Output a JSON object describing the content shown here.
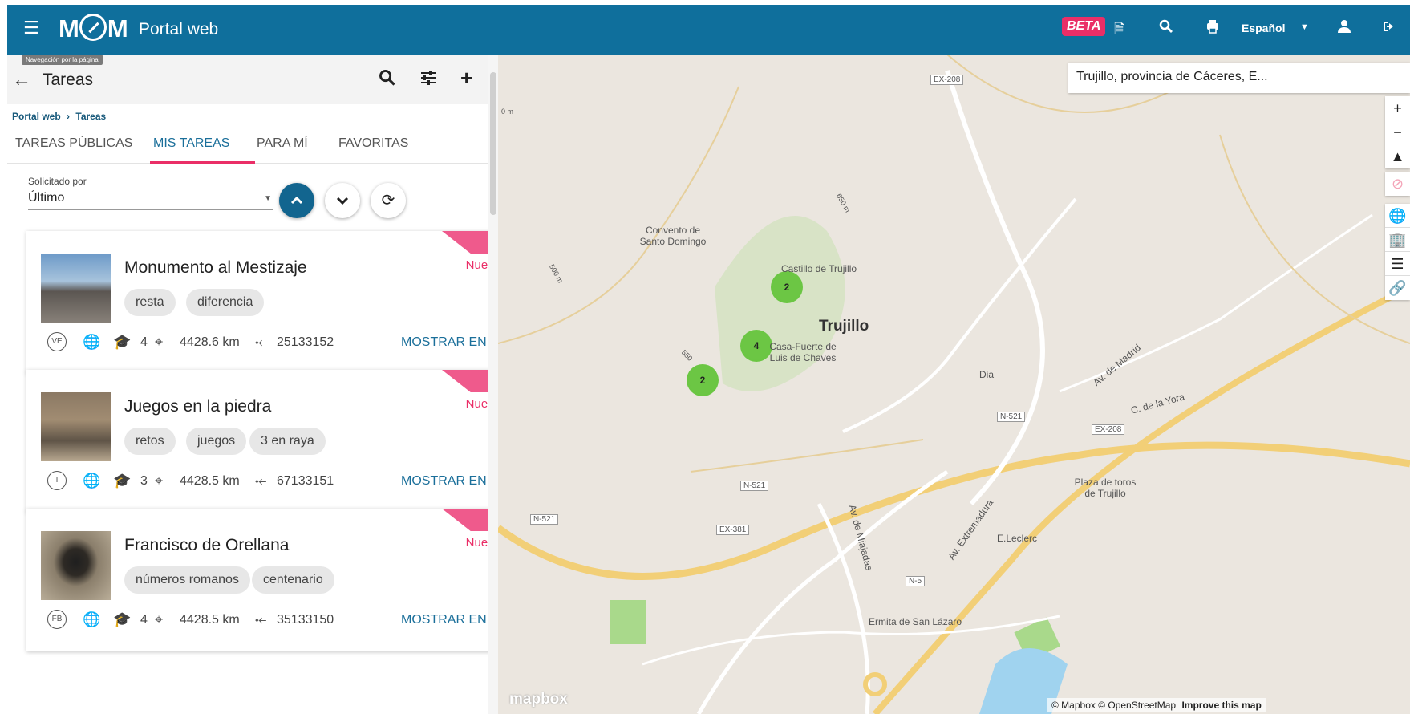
{
  "topbar": {
    "brand": "M",
    "brand_end": "M",
    "portal_title": "Portal web",
    "beta": "BETA",
    "language": "Español"
  },
  "header": {
    "tooltip": "Navegación por la página",
    "title": "Tareas"
  },
  "breadcrumb": {
    "home": "Portal web",
    "sep": "›",
    "current": "Tareas"
  },
  "tabs": [
    {
      "label": "TAREAS PÚBLICAS"
    },
    {
      "label": "MIS TAREAS"
    },
    {
      "label": "PARA MÍ"
    },
    {
      "label": "FAVORITAS"
    }
  ],
  "sort": {
    "label": "Solicitado por",
    "value": "Último"
  },
  "cards": [
    {
      "title": "Monumento al Mestizaje",
      "badge": "Nuevo",
      "tags": [
        "resta",
        "diferencia"
      ],
      "type": "VE",
      "level": "4",
      "distance": "4428.6 km",
      "id": "25133152",
      "action": "MOSTRAR EN EL"
    },
    {
      "title": "Juegos en la piedra",
      "badge": "Nuevo",
      "tags": [
        "retos",
        "juegos",
        "3 en raya"
      ],
      "type": "I",
      "level": "3",
      "distance": "4428.5 km",
      "id": "67133151",
      "action": "MOSTRAR EN EL"
    },
    {
      "title": "Francisco de Orellana",
      "badge": "Nuevo",
      "tags": [
        "números romanos",
        "centenario"
      ],
      "type": "FB",
      "level": "4",
      "distance": "4428.5 km",
      "id": "35133150",
      "action": "MOSTRAR EN EL"
    }
  ],
  "map": {
    "search": "Trujillo, provincia de Cáceres, E...",
    "clusters": [
      "2",
      "4",
      "2"
    ],
    "labels": {
      "trujillo": "Trujillo",
      "castillo": "Castillo de Trujillo",
      "convento": "Convento de Santo Domingo",
      "casa_fuerte": "Casa-Fuerte de Luis de Chaves",
      "dia": "Dia",
      "madrid": "Av. de Madrid",
      "yora": "C. de la Yora",
      "plaza_toros": "Plaza de toros de Trujillo",
      "leclerc": "E.Leclerc",
      "extremadura": "Av. Extremadura",
      "miajadas": "Av. de Miajadas",
      "ermita": "Ermita de San Lázaro",
      "ex208a": "EX-208",
      "ex208b": "EX-208",
      "n521a": "N-521",
      "n521b": "N-521",
      "n521c": "N-521",
      "ex381": "EX-381",
      "n5": "N-5",
      "c650": "650 m",
      "c500": "500 m",
      "c550": "550",
      "c0": "0 m"
    },
    "attribution": "© Mapbox © OpenStreetMap",
    "improve": "Improve this map",
    "mapbox": "mapbox"
  },
  "colors": {
    "topbar": "#0f6f9c",
    "accent": "#ea2e67",
    "link": "#1b6f9a",
    "cluster": "#6cc644"
  }
}
